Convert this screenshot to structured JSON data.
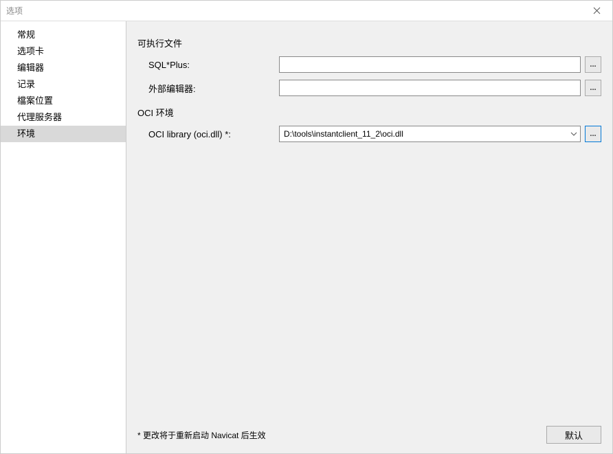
{
  "window": {
    "title": "选项"
  },
  "sidebar": {
    "items": [
      {
        "label": "常规"
      },
      {
        "label": "选项卡"
      },
      {
        "label": "编辑器"
      },
      {
        "label": "记录"
      },
      {
        "label": "檔案位置"
      },
      {
        "label": "代理服务器"
      },
      {
        "label": "环境"
      }
    ]
  },
  "content": {
    "section1_header": "可执行文件",
    "sqlplus_label": "SQL*Plus:",
    "sqlplus_value": "",
    "external_editor_label": "外部编辑器:",
    "external_editor_value": "",
    "section2_header": "OCI 环境",
    "oci_library_label": "OCI library (oci.dll) *:",
    "oci_library_value": "D:\\tools\\instantclient_11_2\\oci.dll",
    "browse_label": "...",
    "footer_note": "* 更改将于重新启动 Navicat 后生效",
    "default_btn_label": "默认"
  }
}
